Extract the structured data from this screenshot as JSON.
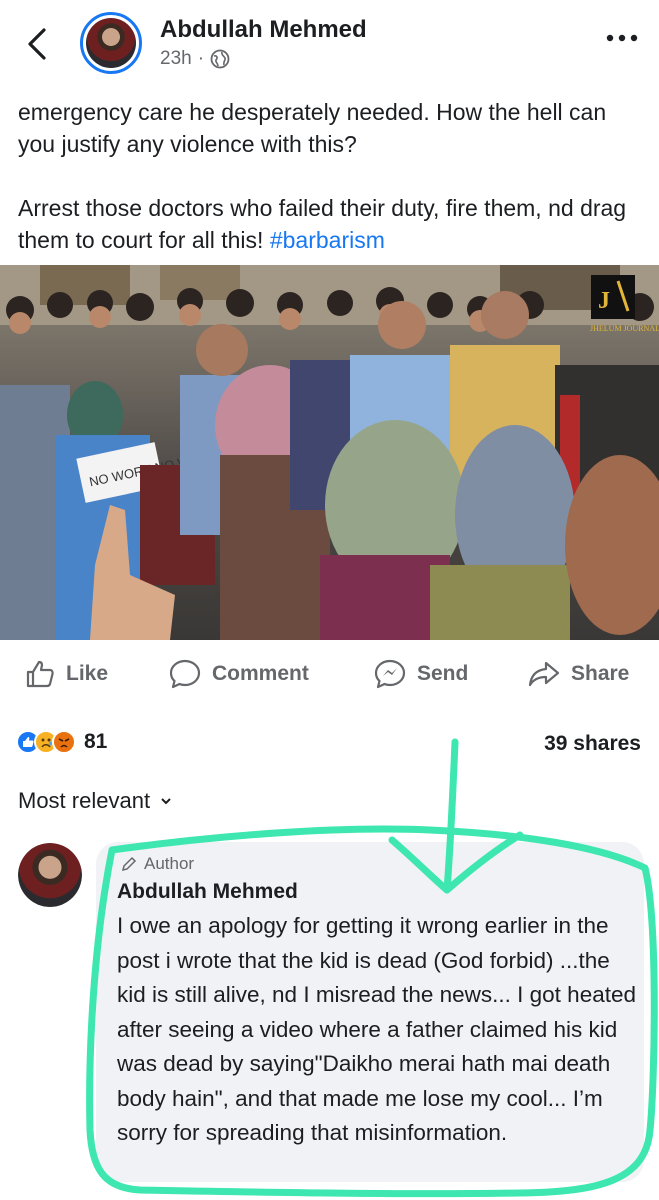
{
  "header": {
    "author": "Abdullah Mehmed",
    "time": "23h",
    "separator": "·"
  },
  "post": {
    "paragraph1": "emergency care he desperately needed. How the hell can you justify any violence with this?",
    "paragraph2": "Arrest those doctors who failed their duty, fire them, nd drag them to court for all this! ",
    "hashtag": "#barbarism",
    "watermark": "JHELUM JOURNAL",
    "placard_text": "NO WORK NO WORK"
  },
  "actions": {
    "like": "Like",
    "comment": "Comment",
    "send": "Send",
    "share": "Share"
  },
  "stats": {
    "reaction_count": "81",
    "shares": "39 shares",
    "reaction_icons": [
      "like-reaction",
      "sad-reaction",
      "angry-reaction"
    ]
  },
  "comments": {
    "sort_label": "Most relevant",
    "items": [
      {
        "badge": "Author",
        "name": "Abdullah Mehmed",
        "text": "I owe an apology for getting it wrong earlier in the post i wrote that the kid is dead (God forbid) ...the kid is still alive, nd I misread the news... I got heated after seeing a video where a father claimed his kid was dead by saying\"Daikho merai hath mai death body hain\", and that made me lose my cool... I’m sorry for spreading that misinformation."
      }
    ]
  },
  "colors": {
    "brand_blue": "#1877f2",
    "secondary_text": "#65676b",
    "bubble_bg": "#f0f2f5",
    "marker_green": "#3ee6b0"
  }
}
